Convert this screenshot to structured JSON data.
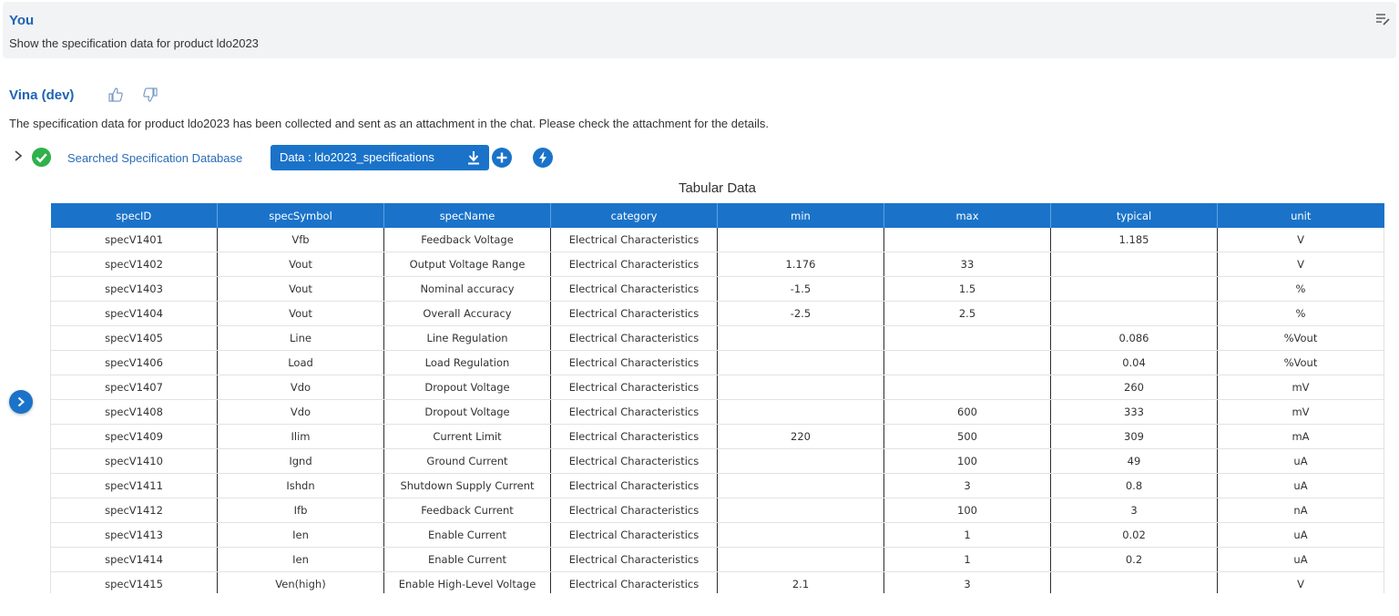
{
  "user": {
    "name": "You",
    "message": "Show the specification data for product ldo2023"
  },
  "bot": {
    "name": "Vina (dev)",
    "message": "The specification data for product ldo2023 has been collected and sent as an attachment in the chat. Please check the attachment for the details.",
    "tool_label": "Searched Specification Database",
    "data_button": "Data : ldo2023_specifications"
  },
  "icons": {
    "edit": "edit-icon",
    "thumbs_up": "thumbs-up-icon",
    "thumbs_down": "thumbs-down-icon",
    "check": "check-circle-icon",
    "download": "download-icon",
    "add": "plus-circle-icon",
    "lightning": "lightning-icon",
    "expand": "chevron-right-icon"
  },
  "colors": {
    "accent": "#1a73c9",
    "name": "#1f63b5",
    "success": "#2fb14b",
    "user_bg": "#f2f3f5"
  },
  "table": {
    "title": "Tabular Data",
    "columns": [
      "specID",
      "specSymbol",
      "specName",
      "category",
      "min",
      "max",
      "typical",
      "unit"
    ],
    "rows": [
      [
        "specV1401",
        "Vfb",
        "Feedback Voltage",
        "Electrical Characteristics",
        "",
        "",
        "1.185",
        "V"
      ],
      [
        "specV1402",
        "Vout",
        "Output Voltage Range",
        "Electrical Characteristics",
        "1.176",
        "33",
        "",
        "V"
      ],
      [
        "specV1403",
        "Vout",
        "Nominal accuracy",
        "Electrical Characteristics",
        "-1.5",
        "1.5",
        "",
        "%"
      ],
      [
        "specV1404",
        "Vout",
        "Overall Accuracy",
        "Electrical Characteristics",
        "-2.5",
        "2.5",
        "",
        "%"
      ],
      [
        "specV1405",
        "Line",
        "Line Regulation",
        "Electrical Characteristics",
        "",
        "",
        "0.086",
        "%Vout"
      ],
      [
        "specV1406",
        "Load",
        "Load Regulation",
        "Electrical Characteristics",
        "",
        "",
        "0.04",
        "%Vout"
      ],
      [
        "specV1407",
        "Vdo",
        "Dropout Voltage",
        "Electrical Characteristics",
        "",
        "",
        "260",
        "mV"
      ],
      [
        "specV1408",
        "Vdo",
        "Dropout Voltage",
        "Electrical Characteristics",
        "",
        "600",
        "333",
        "mV"
      ],
      [
        "specV1409",
        "Ilim",
        "Current Limit",
        "Electrical Characteristics",
        "220",
        "500",
        "309",
        "mA"
      ],
      [
        "specV1410",
        "Ignd",
        "Ground Current",
        "Electrical Characteristics",
        "",
        "100",
        "49",
        "uA"
      ],
      [
        "specV1411",
        "Ishdn",
        "Shutdown Supply Current",
        "Electrical Characteristics",
        "",
        "3",
        "0.8",
        "uA"
      ],
      [
        "specV1412",
        "Ifb",
        "Feedback Current",
        "Electrical Characteristics",
        "",
        "100",
        "3",
        "nA"
      ],
      [
        "specV1413",
        "Ien",
        "Enable Current",
        "Electrical Characteristics",
        "",
        "1",
        "0.02",
        "uA"
      ],
      [
        "specV1414",
        "Ien",
        "Enable Current",
        "Electrical Characteristics",
        "",
        "1",
        "0.2",
        "uA"
      ],
      [
        "specV1415",
        "Ven(high)",
        "Enable High-Level Voltage",
        "Electrical Characteristics",
        "2.1",
        "3",
        "",
        "V"
      ]
    ]
  }
}
